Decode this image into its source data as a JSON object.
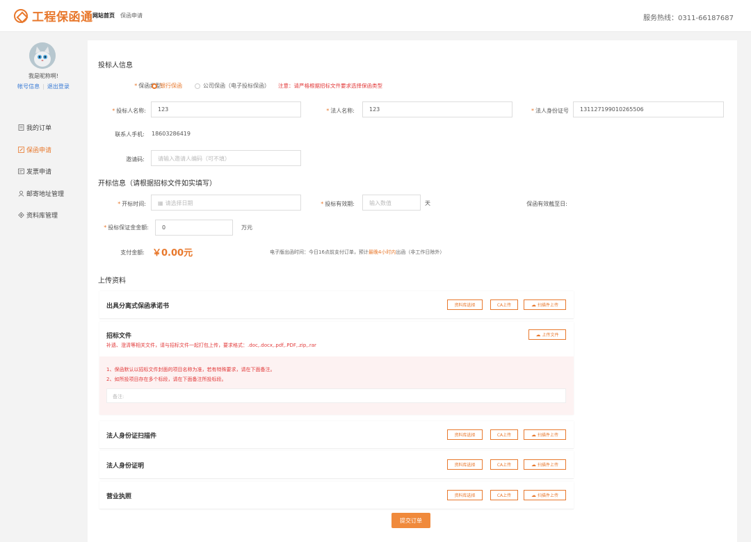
{
  "header": {
    "logo_text": "工程保函通",
    "nav": [
      "网站首页",
      "保函申请"
    ],
    "hotline": "服务热线：0311-66187687"
  },
  "sidebar": {
    "greeting": "我是昵称啊!",
    "edit_link": "帐号信息",
    "logout_link": "退出登录",
    "menu": [
      {
        "label": "我的订单",
        "icon": "document-icon"
      },
      {
        "label": "保函申请",
        "icon": "edit-icon"
      },
      {
        "label": "发票申请",
        "icon": "invoice-icon"
      },
      {
        "label": "邮寄地址管理",
        "icon": "user-location-icon"
      },
      {
        "label": "资料库管理",
        "icon": "database-icon"
      }
    ]
  },
  "bidder": {
    "title": "投标人信息",
    "guarantee_type_label": "保函类型:",
    "type_bank": "银行保函",
    "type_company": "公司保函（电子投标保函）",
    "type_notice": "注意：请严格根据招标文件要求选择保函类型",
    "bidder_name_label": "投标人名称:",
    "bidder_name_value": "123",
    "legal_name_label": "法人名称:",
    "legal_name_value": "123",
    "legal_id_label": "法人身份证号",
    "legal_id_value": "131127199010265506",
    "phone_label": "联系人手机:",
    "phone_value": "18603286419",
    "invite_label": "邀请码:",
    "invite_placeholder": "请输入邀请人编码（可不填）"
  },
  "opening": {
    "title": "开标信息（请根据招标文件如实填写）",
    "open_time_label": "开标时间:",
    "open_time_placeholder": "请选择日期",
    "validity_label": "投标有效期:",
    "validity_placeholder": "输入数值",
    "validity_unit": "天",
    "valid_until_label": "保函有效截至日:",
    "deposit_label": "投标保证金金额:",
    "deposit_value": "0",
    "deposit_unit": "万元",
    "pay_label": "支付金额:",
    "pay_amount": "￥0.00元",
    "tip_prefix": "电子版出函时间：今日16点前支付订单，预计",
    "tip_highlight": "最晚4小时内",
    "tip_suffix": "出函（非工作日除外）"
  },
  "upload": {
    "title": "上传资料",
    "btn_library": "资料库选择",
    "btn_ca": "CA上传",
    "btn_scan": "扫描件上传",
    "btn_file": "上传文件",
    "cards": [
      {
        "title": "出具分离式保函承诺书"
      },
      {
        "title": "法人身份证扫描件"
      },
      {
        "title": "法人身份证明"
      },
      {
        "title": "营业执照"
      }
    ],
    "tender": {
      "title": "招标文件",
      "desc": "补遗、澄清等相关文件，请与招标文件一起打包上传，要求格式：.doc,.docx,.pdf,.PDF,.zip,.rar",
      "note1": "1、保函默认以招标文件封面的项目名称为准，若有特殊要求，请在下面备注。",
      "note2": "2、如所投项目存在多个标段，请在下面备注所投标段。",
      "remark_placeholder": "备注:"
    }
  },
  "submit_label": "提交订单",
  "colors": {
    "accent": "#e8782c",
    "link": "#3a7bd5",
    "notice": "#e23a3a",
    "pink_bg": "#fdf2f2"
  }
}
